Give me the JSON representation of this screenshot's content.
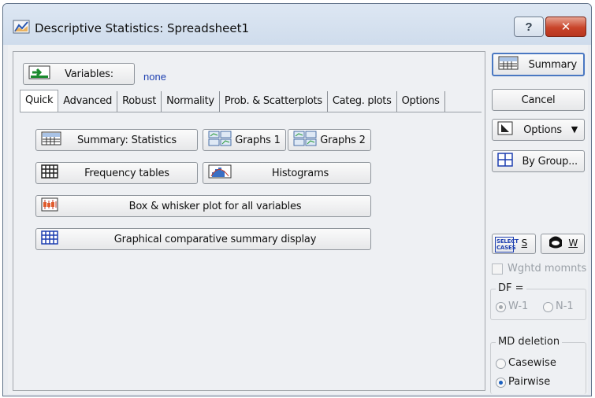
{
  "window": {
    "title": "Descriptive Statistics: Spreadsheet1",
    "help_glyph": "?",
    "close_glyph": "✕"
  },
  "variables": {
    "button_label": "Variables:",
    "value": "none"
  },
  "tabs": [
    {
      "label": "Quick",
      "active": true
    },
    {
      "label": "Advanced",
      "active": false
    },
    {
      "label": "Robust",
      "active": false
    },
    {
      "label": "Normality",
      "active": false
    },
    {
      "label": "Prob. & Scatterplots",
      "active": false
    },
    {
      "label": "Categ. plots",
      "active": false
    },
    {
      "label": "Options",
      "active": false
    }
  ],
  "quick": {
    "summary_statistics": "Summary: Statistics",
    "graphs_1": "Graphs 1",
    "graphs_2": "Graphs 2",
    "frequency_tables": "Frequency tables",
    "histograms": "Histograms",
    "box_whisker": "Box & whisker plot for all variables",
    "graphical_comparative": "Graphical comparative summary display"
  },
  "side": {
    "summary": "Summary",
    "cancel": "Cancel",
    "options": "Options",
    "options_arrow": "▼",
    "by_group": "By Group...",
    "select_cases_icon_text": "SELECT CASES",
    "select_cases_key": "S",
    "weight_key": "W",
    "weighted_moments": "Wghtd momnts",
    "df_label": "DF =",
    "df_w1": "W-1",
    "df_n1": "N-1",
    "md_deletion": "MD deletion",
    "casewise": "Casewise",
    "pairwise": "Pairwise"
  },
  "colors": {
    "accent_blue": "#1d3fb0",
    "close_red": "#c8442a",
    "window_bg": "#eef0f3"
  }
}
